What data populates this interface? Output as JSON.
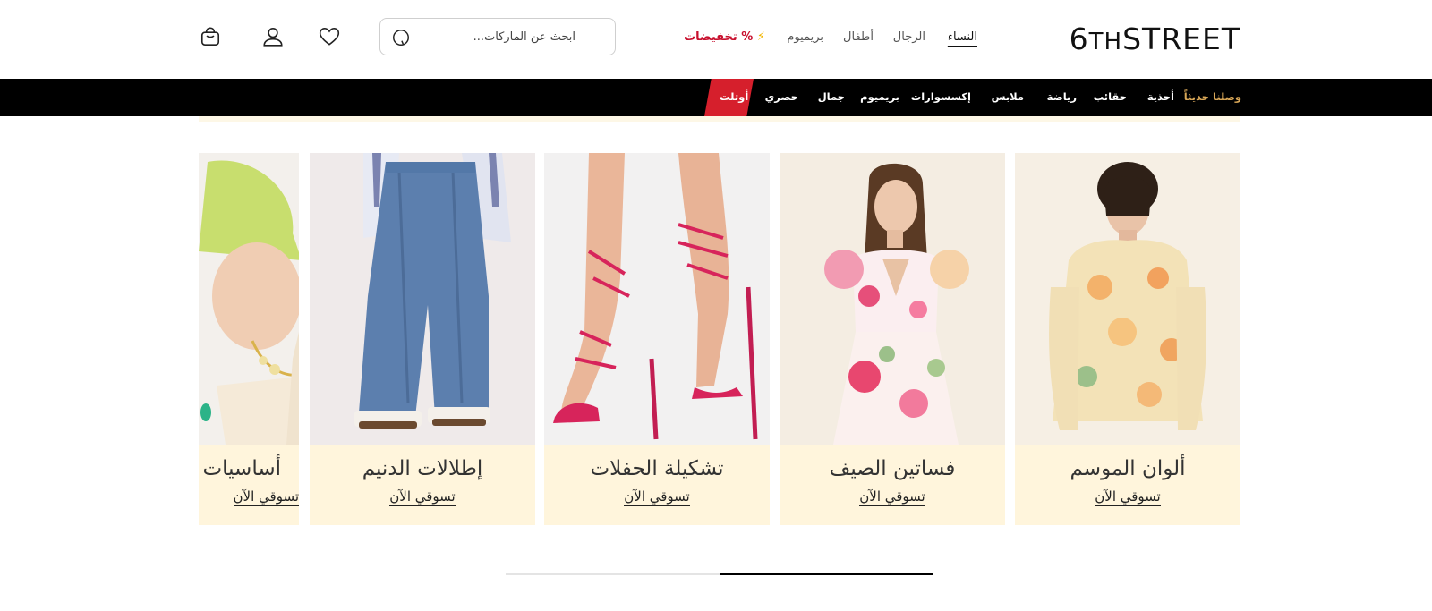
{
  "header": {
    "logo": {
      "main": "6",
      "small": "TH",
      "rest": "STREET"
    },
    "nav": {
      "women": "النساء",
      "men": "الرجال",
      "kids": "أطفال",
      "premium": "بريميوم",
      "sale": "تخفيضات %",
      "sale_icon": "⚡"
    },
    "search": {
      "placeholder": "ابحث عن الماركات..."
    },
    "icons": [
      "search-icon",
      "heart-icon",
      "user-icon",
      "bag-icon"
    ]
  },
  "categories": {
    "new_arrivals": "وصلنا حديثاً",
    "shoes": "أحذية",
    "bags": "حقائب",
    "sports": "رياضة",
    "clothing": "ملابس",
    "accessories": "إكسسوارات",
    "premium": "بريميوم",
    "beauty": "جمال",
    "exclusive": "حصري",
    "outlet": "أوتلت",
    "outlet_color": "#d61f2c",
    "new_arrivals_color": "#d8a657"
  },
  "cards": [
    {
      "title": "ألوان الموسم",
      "cta": "تسوقي الآن"
    },
    {
      "title": "فساتين الصيف",
      "cta": "تسوقي الآن"
    },
    {
      "title": "تشكيلة الحفلات",
      "cta": "تسوقي الآن"
    },
    {
      "title": "إطلالات الدنيم",
      "cta": "تسوقي الآن"
    },
    {
      "title": "أساسيات",
      "cta": "تسوقي الآن"
    }
  ],
  "pagination": {
    "pages": 2,
    "active_page": 2,
    "progress_fraction": 0.5
  }
}
